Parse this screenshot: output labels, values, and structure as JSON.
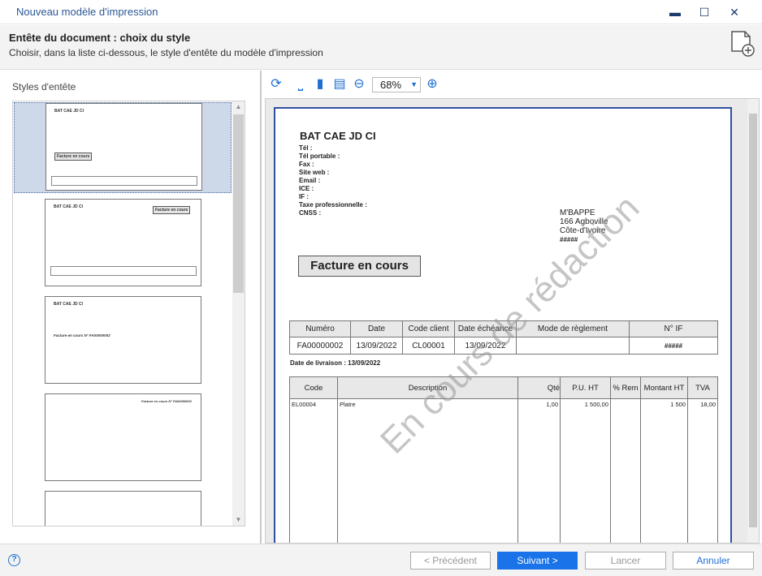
{
  "window": {
    "title": "Nouveau modèle d'impression",
    "minimize": "▬",
    "maximize": "☐",
    "close": "✕"
  },
  "header": {
    "title": "Entête du document : choix du style",
    "subtitle": "Choisir, dans la liste ci-dessous, le style d'entête du modèle d'impression"
  },
  "left": {
    "label": "Styles d'entête"
  },
  "thumbs": [
    {
      "company": "BAT CAE JD CI",
      "btn": "Facture en cours"
    },
    {
      "company": "BAT CAE JD CI",
      "btn": "Facture en cours"
    },
    {
      "company": "BAT CAE JD CI",
      "text": "Facture en cours N° FA00000002"
    },
    {
      "text": "Facture en cours N° FA00000002"
    }
  ],
  "toolbar": {
    "zoom": "68%"
  },
  "doc": {
    "company": "BAT CAE JD CI",
    "fields": [
      "Tél :",
      "Tél portable :",
      "Fax :",
      "Site web :",
      "Email :",
      "ICE :",
      "IF :",
      "Taxe professionnelle :",
      "CNSS :"
    ],
    "addr": [
      "M'BAPPE",
      "166 Agboville",
      "Côte-d'Ivoire",
      "#####"
    ],
    "status": "Facture en cours",
    "t1": {
      "headers": [
        "Numéro",
        "Date",
        "Code client",
        "Date échéance",
        "Mode de règlement",
        "N° IF"
      ],
      "row": [
        "FA00000002",
        "13/09/2022",
        "CL00001",
        "13/09/2022",
        "",
        "#####"
      ]
    },
    "livraison": "Date de livraison : 13/09/2022",
    "t2": {
      "headers": [
        "Code",
        "Description",
        "Qté",
        "P.U. HT",
        "% Rem",
        "Montant HT",
        "TVA"
      ],
      "row": [
        "EL00004",
        "Platre",
        "1,00",
        "1 500,00",
        "",
        "1 500",
        "18,00"
      ]
    },
    "watermark": "En cours de rédaction"
  },
  "footer": {
    "help": "?",
    "prev": "< Précédent",
    "next": "Suivant >",
    "cancel": "Lancer",
    "annuler": "Annuler"
  }
}
